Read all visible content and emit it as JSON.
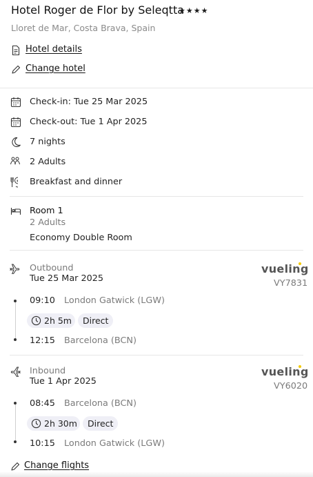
{
  "hotel": {
    "name": "Hotel Roger de Flor by Seleqtta",
    "stars": "★★★★",
    "location": "Lloret de Mar, Costa Brava, Spain",
    "details_link": "Hotel details",
    "change_link": "Change hotel"
  },
  "stay": {
    "checkin": "Check-in: Tue 25 Mar 2025",
    "checkout": "Check-out: Tue 1 Apr 2025",
    "nights": "7 nights",
    "guests": "2 Adults",
    "board": "Breakfast and dinner"
  },
  "room": {
    "title": "Room 1",
    "guests": "2 Adults",
    "type": "Economy Double Room"
  },
  "outbound": {
    "label": "Outbound",
    "date": "Tue 25 Mar 2025",
    "airline": "vueling",
    "flight_no": "VY7831",
    "depart_time": "09:10",
    "depart_airport": "London Gatwick (LGW)",
    "duration": "2h 5m",
    "stops": "Direct",
    "arrive_time": "12:15",
    "arrive_airport": "Barcelona (BCN)"
  },
  "inbound": {
    "label": "Inbound",
    "date": "Tue 1 Apr 2025",
    "airline": "vueling",
    "flight_no": "VY6020",
    "depart_time": "08:45",
    "depart_airport": "Barcelona (BCN)",
    "duration": "2h 30m",
    "stops": "Direct",
    "arrive_time": "10:15",
    "arrive_airport": "London Gatwick (LGW)"
  },
  "flights": {
    "change_link": "Change flights"
  },
  "colors": {
    "accent_dot": "#f3c900",
    "divider": "#e6e6e6",
    "pill_bg": "#efeff6"
  }
}
